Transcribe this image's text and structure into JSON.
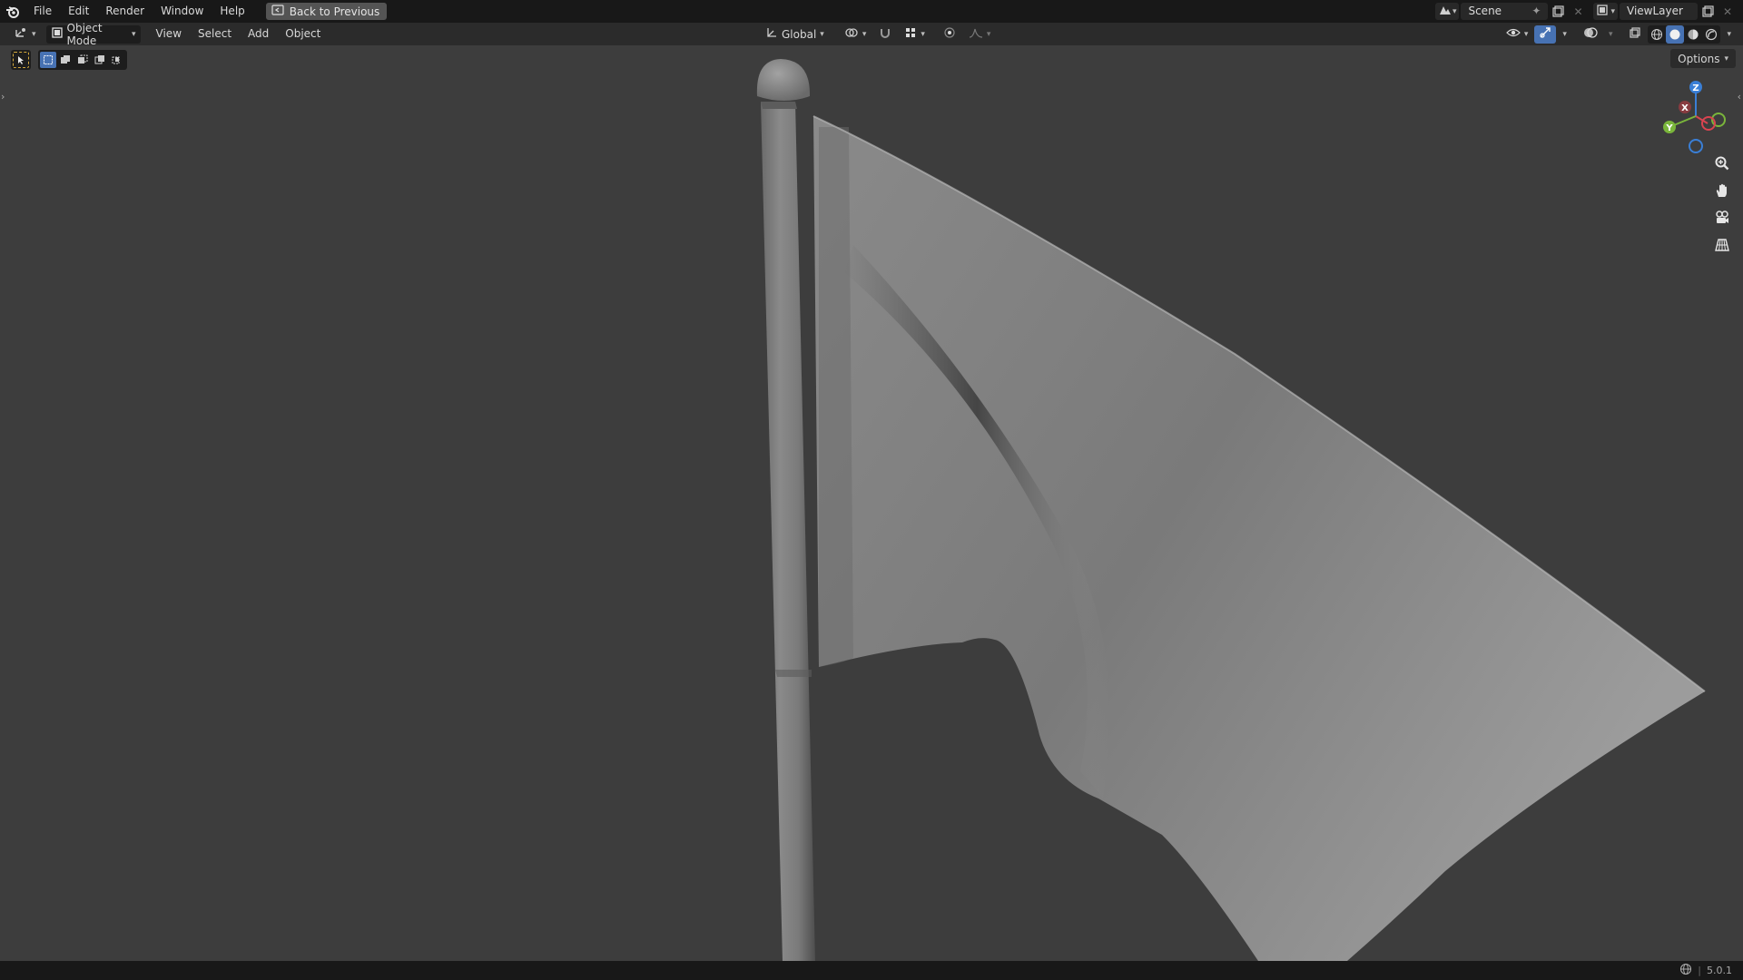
{
  "menu": {
    "items": [
      "File",
      "Edit",
      "Render",
      "Window",
      "Help"
    ],
    "back_label": "Back to Previous"
  },
  "top_right": {
    "scene": "Scene",
    "view_layer": "ViewLayer"
  },
  "header": {
    "mode": "Object Mode",
    "menus": [
      "View",
      "Select",
      "Add",
      "Object"
    ],
    "transform_orientation": "Global",
    "options_label": "Options"
  },
  "gizmo": {
    "z": "Z",
    "y": "Y",
    "x": "X"
  },
  "status": {
    "version": "5.0.1"
  },
  "colors": {
    "accent": "#4772b3",
    "axis_x": "#d94450",
    "axis_y": "#7ab53b",
    "axis_z": "#3a7fd6"
  }
}
